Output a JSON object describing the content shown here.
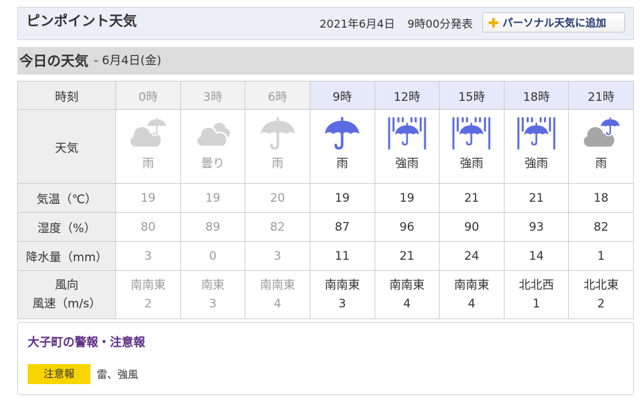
{
  "header": {
    "title": "ピンポイント天気",
    "announce_date": "2021年6月4日",
    "announce_time": "9時00分発表",
    "add_button": {
      "icon": "plus-icon",
      "label": "パーソナル天気に追加"
    }
  },
  "today": {
    "heading": "今日の天気",
    "date": "- 6月4日(金)"
  },
  "table": {
    "labels": {
      "time": "時刻",
      "weather": "天気",
      "temperature": "気温（℃）",
      "humidity": "湿度（%）",
      "precipitation": "降水量（mm）",
      "wind_direction": "風向",
      "wind_speed": "風速（m/s）"
    },
    "columns": [
      {
        "time": "0時",
        "past": true,
        "icon": "rain-cloud-icon",
        "weather": "雨",
        "temperature": "19",
        "humidity": "80",
        "precipitation": "3",
        "wind_direction": "南南東",
        "wind_speed": "2"
      },
      {
        "time": "3時",
        "past": true,
        "icon": "cloud-icon",
        "weather": "曇り",
        "temperature": "19",
        "humidity": "89",
        "precipitation": "0",
        "wind_direction": "南東",
        "wind_speed": "3"
      },
      {
        "time": "6時",
        "past": true,
        "icon": "umbrella-icon",
        "weather": "雨",
        "temperature": "20",
        "humidity": "82",
        "precipitation": "3",
        "wind_direction": "南南東",
        "wind_speed": "4"
      },
      {
        "time": "9時",
        "past": false,
        "icon": "umbrella-icon",
        "weather": "雨",
        "temperature": "19",
        "humidity": "87",
        "precipitation": "11",
        "wind_direction": "南南東",
        "wind_speed": "3"
      },
      {
        "time": "12時",
        "past": false,
        "icon": "heavy-rain-umbrella-icon",
        "weather": "強雨",
        "temperature": "19",
        "humidity": "96",
        "precipitation": "21",
        "wind_direction": "南南東",
        "wind_speed": "4"
      },
      {
        "time": "15時",
        "past": false,
        "icon": "heavy-rain-umbrella-icon",
        "weather": "強雨",
        "temperature": "21",
        "humidity": "90",
        "precipitation": "24",
        "wind_direction": "南南東",
        "wind_speed": "4"
      },
      {
        "time": "18時",
        "past": false,
        "icon": "heavy-rain-umbrella-icon",
        "weather": "強雨",
        "temperature": "21",
        "humidity": "93",
        "precipitation": "14",
        "wind_direction": "北北西",
        "wind_speed": "1"
      },
      {
        "time": "21時",
        "past": false,
        "icon": "rain-cloud-icon",
        "weather": "雨",
        "temperature": "18",
        "humidity": "82",
        "precipitation": "1",
        "wind_direction": "北北東",
        "wind_speed": "2"
      }
    ]
  },
  "warnings": {
    "title": "大子町の警報・注意報",
    "badge": "注意報",
    "items": "雷、強風"
  },
  "colors": {
    "header_bar_bg": "#eceff8",
    "header_active_bg": "#e5e9fa",
    "text_past": "#9c9c9c",
    "icon_active": "#5b6be0",
    "icon_past": "#d3d3d3",
    "cloud_active": "#a6a6a6",
    "plus_icon": "#f2b400",
    "warning_badge": "#f9d500",
    "warning_title": "#5e2e88"
  }
}
